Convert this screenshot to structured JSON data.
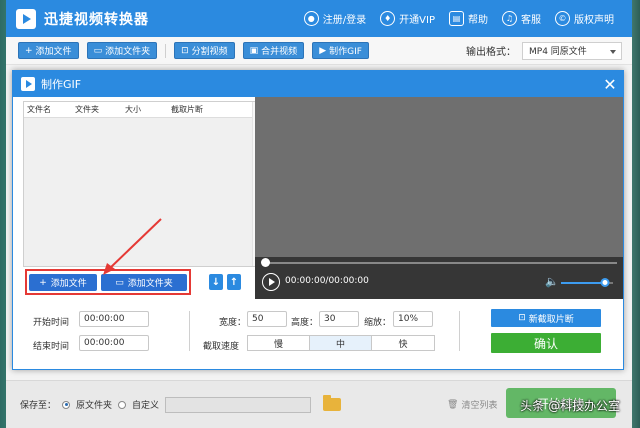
{
  "app": {
    "title": "迅捷视频转换器",
    "top_links": [
      {
        "label": "注册/登录",
        "icon": "user-icon"
      },
      {
        "label": "开通VIP",
        "icon": "vip-icon"
      },
      {
        "label": "帮助",
        "icon": "help-icon"
      },
      {
        "label": "客服",
        "icon": "headset-icon"
      },
      {
        "label": "版权声明",
        "icon": "copyright-icon"
      }
    ]
  },
  "toolbar": {
    "add_file": "添加文件",
    "add_folder": "添加文件夹",
    "split_video": "分割视频",
    "merge_video": "合并视频",
    "make_gif": "制作GIF",
    "output_format_label": "输出格式：",
    "output_format_value": "MP4  同原文件"
  },
  "dialog": {
    "title": "制作GIF",
    "close": "✕",
    "table_headers": [
      "文件名",
      "文件夹",
      "大小",
      "截取片断"
    ],
    "add_file": "添加文件",
    "add_folder": "添加文件夹",
    "move_down": "↓",
    "move_up": "↑",
    "player": {
      "time": "00:00:00/00:00:00",
      "volume_level": 0.85
    },
    "settings": {
      "start_label": "开始时间",
      "start_value": "00:00:00",
      "end_label": "结束时间",
      "end_value": "00:00:00",
      "width_label": "宽度：",
      "width_value": "50",
      "height_label": "高度：",
      "height_value": "30",
      "scale_label": "缩放：",
      "scale_value": "10%",
      "speed_label": "截取速度",
      "speed_options": [
        "慢",
        "中",
        "快"
      ],
      "speed_selected": "中",
      "new_capture": "新截取片断",
      "confirm": "确认"
    }
  },
  "bottom": {
    "save_to_label": "保存至：",
    "opt_original": "原文件夹",
    "opt_custom": "自定义",
    "clear_list": "清空列表",
    "start_button": "开始转换",
    "watermark": "头条 @科技办公室"
  },
  "colors": {
    "brand_blue": "#2b8ae0",
    "confirm_green": "#3cae34",
    "highlight_red": "#e53935"
  }
}
